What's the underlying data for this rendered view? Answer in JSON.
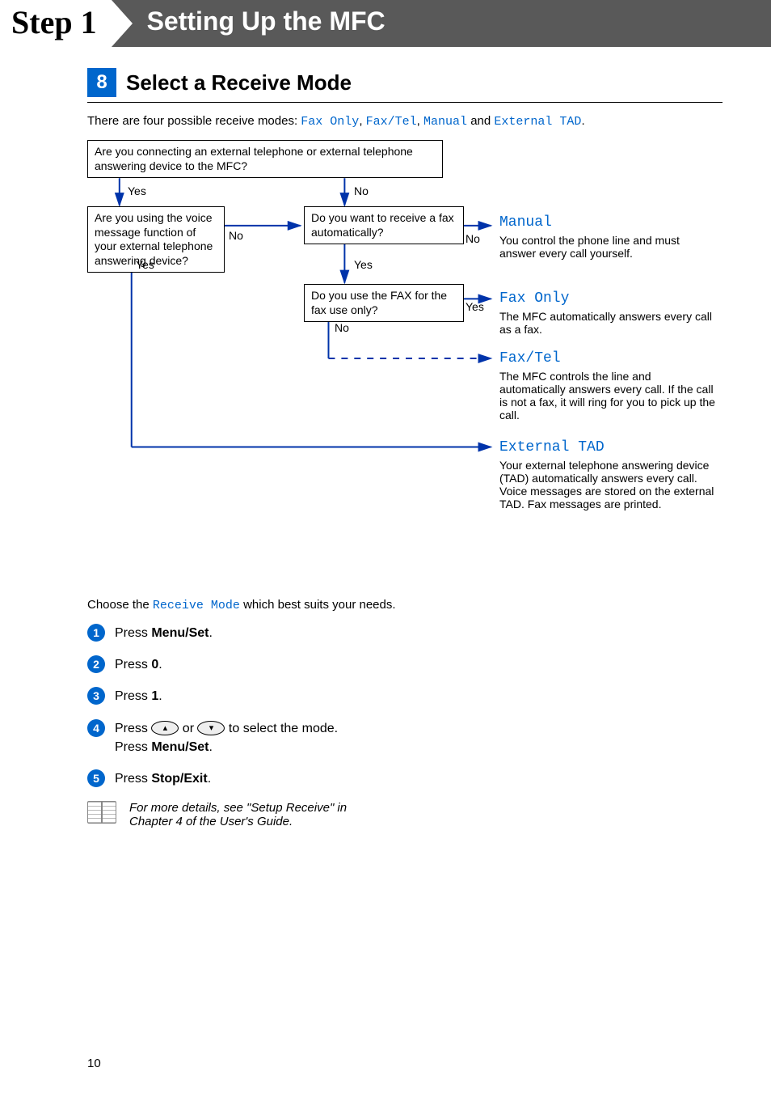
{
  "header": {
    "step": "Step 1",
    "title": "Setting Up the MFC"
  },
  "section": {
    "number": "8",
    "title": "Select a Receive Mode"
  },
  "intro": {
    "prefix": "There are four possible receive modes: ",
    "m1": "Fax Only",
    "sep1": ", ",
    "m2": "Fax/Tel",
    "sep2": ", ",
    "m3": "Manual",
    "sep3": " and ",
    "m4": "External TAD",
    "suffix": "."
  },
  "flow": {
    "q1": "Are you connecting an external telephone or external telephone answering device to the MFC?",
    "q2": "Are you using the voice message function of your external telephone answering device?",
    "q3": "Do you want to receive a fax automatically?",
    "q4": "Do you use the FAX for the fax use only?",
    "yes1": "Yes",
    "no1": "No",
    "yes2": "Yes",
    "no2": "No",
    "yes3": "Yes",
    "no3": "No",
    "yes4": "Yes",
    "no4": "No",
    "modes": {
      "manual": {
        "title": "Manual",
        "desc": "You control the phone line and must answer every call yourself."
      },
      "faxonly": {
        "title": "Fax Only",
        "desc": "The MFC automatically answers every call as a fax."
      },
      "faxtel": {
        "title": "Fax/Tel",
        "desc": "The MFC controls the line and automatically answers every call. If the call is not a fax, it will ring for you to pick up the call."
      },
      "exttad": {
        "title": "External TAD",
        "desc": "Your external telephone answering device (TAD) automatically answers every call. Voice messages are stored on the external TAD. Fax messages are printed."
      }
    }
  },
  "choose": {
    "prefix": "Choose the ",
    "mode": "Receive Mode",
    "suffix": " which best suits your needs."
  },
  "steps": {
    "s1_a": "Press ",
    "s1_b": "Menu/Set",
    "s1_c": ".",
    "s2_a": "Press ",
    "s2_b": "0",
    "s2_c": ".",
    "s3_a": "Press ",
    "s3_b": "1",
    "s3_c": ".",
    "s4_a": "Press ",
    "s4_mid": " or ",
    "s4_b": " to select the mode.",
    "s4_c": "Press ",
    "s4_d": "Menu/Set",
    "s4_e": ".",
    "s5_a": "Press ",
    "s5_b": "Stop/Exit",
    "s5_c": "."
  },
  "note": "For more details, see \"Setup Receive\" in Chapter 4 of the User's Guide.",
  "page": "10"
}
